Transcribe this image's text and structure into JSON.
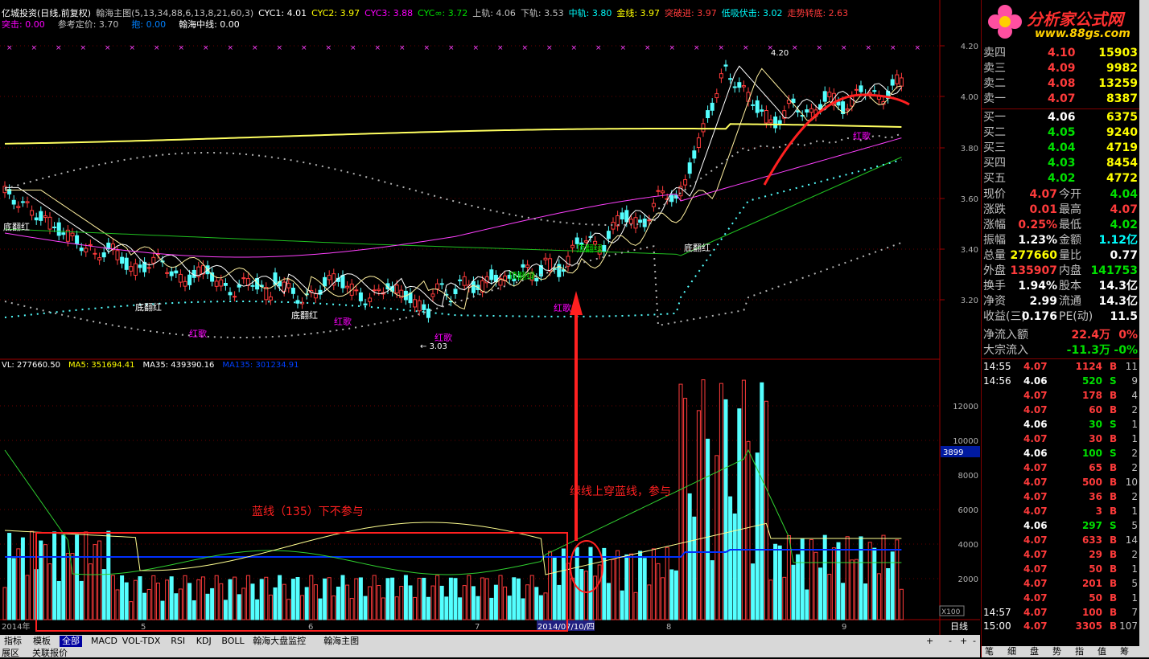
{
  "header": {
    "line1": [
      {
        "text": "亿城投资(日线,前复权)",
        "color": "#ffffff"
      },
      {
        "text": "翰海主图(5,13,34,88,6,13,8,21,60,3)",
        "color": "#c0c0c0"
      },
      {
        "text": "CYC1: 4.01",
        "color": "#ffffff"
      },
      {
        "text": "CYC2: 3.97",
        "color": "#ffff00"
      },
      {
        "text": "CYC3: 3.88",
        "color": "#ff00ff"
      },
      {
        "text": "CYC∞: 3.72",
        "color": "#00e000"
      },
      {
        "text": "上轨: 4.06",
        "color": "#c0c0c0"
      },
      {
        "text": "下轨: 3.53",
        "color": "#c0c0c0"
      },
      {
        "text": "中轨: 3.80",
        "color": "#00ffff"
      },
      {
        "text": "金线: 3.97",
        "color": "#ffff00"
      },
      {
        "text": "突破进: 3.97",
        "color": "#ff3b3b"
      },
      {
        "text": "低吸伏击: 3.02",
        "color": "#00ffff"
      },
      {
        "text": "走势转底: 2.63",
        "color": "#ff3b3b"
      }
    ],
    "line2": [
      {
        "text": "突击: 0.00",
        "color": "#ff00ff"
      },
      {
        "text": "参考定价: 3.70",
        "color": "#c0c0c0"
      },
      {
        "text": "抱: 0.00",
        "color": "#0080ff"
      },
      {
        "text": "翰海中线: 0.00",
        "color": "#ffffff"
      }
    ]
  },
  "price_axis": [
    "4.20",
    "4.00",
    "3.80",
    "3.60",
    "3.40",
    "3.20"
  ],
  "volume_axis": [
    "12000",
    "10000",
    "8000",
    "6000",
    "4000",
    "2000"
  ],
  "volume_axis_marker": "3899",
  "volume_header": [
    {
      "text": "VL: 277660.50",
      "color": "#ffffff"
    },
    {
      "text": "MA5: 351694.41",
      "color": "#ffff00"
    },
    {
      "text": "MA35: 439390.16",
      "color": "#ffffff"
    },
    {
      "text": "MA135: 301234.91",
      "color": "#0040ff"
    }
  ],
  "chart_labels": {
    "high": "4.20",
    "low": "3.03",
    "signals": [
      {
        "text": "底翻红",
        "color": "#ffffff"
      },
      {
        "text": "底翻红",
        "color": "#ffffff"
      },
      {
        "text": "红歌",
        "color": "#ff00ff"
      },
      {
        "text": "底翻红",
        "color": "#ffffff"
      },
      {
        "text": "红歌",
        "color": "#ff00ff"
      },
      {
        "text": "红歌",
        "color": "#ff00ff"
      },
      {
        "text": "顶翻绿",
        "color": "#00e000"
      },
      {
        "text": "红歌",
        "color": "#ff00ff"
      },
      {
        "text": "顶翻绿",
        "color": "#00e000"
      },
      {
        "text": "底翻红",
        "color": "#ffffff"
      },
      {
        "text": "红歌",
        "color": "#ff00ff"
      }
    ],
    "annotation_left": "蓝线（135）下不参与",
    "annotation_right": "绿线上穿蓝线，参与"
  },
  "time_axis": {
    "labels": [
      "2014年",
      "5",
      "6",
      "7",
      "2014/07/10/四",
      "8",
      "9"
    ],
    "period": "日线"
  },
  "tabs": [
    "指标",
    "模板",
    "全部",
    "MACD",
    "VOL-TDX",
    "RSI",
    "KDJ",
    "BOLL",
    "翰海大盘监控",
    "翰海主图"
  ],
  "tab_active": "全部",
  "scroll_buttons": [
    "+",
    "-",
    "+",
    "-"
  ],
  "status": [
    "展区",
    "关联报价"
  ],
  "logo": {
    "title": "分析家公式网",
    "url": "www.88gs.com"
  },
  "order_book": {
    "asks": [
      {
        "label": "卖四",
        "price": "4.10",
        "vol": "15903"
      },
      {
        "label": "卖三",
        "price": "4.09",
        "vol": "9982"
      },
      {
        "label": "卖二",
        "price": "4.08",
        "vol": "13259"
      },
      {
        "label": "卖一",
        "price": "4.07",
        "vol": "8387"
      }
    ],
    "bids": [
      {
        "label": "买一",
        "price": "4.06",
        "vol": "6375"
      },
      {
        "label": "买二",
        "price": "4.05",
        "vol": "9240"
      },
      {
        "label": "买三",
        "price": "4.04",
        "vol": "4719"
      },
      {
        "label": "买四",
        "price": "4.03",
        "vol": "8454"
      },
      {
        "label": "买五",
        "price": "4.02",
        "vol": "4772"
      }
    ]
  },
  "quote": [
    {
      "l1": "现价",
      "v1": "4.07",
      "c1": "red",
      "l2": "今开",
      "v2": "4.04",
      "c2": "green"
    },
    {
      "l1": "涨跌",
      "v1": "0.01",
      "c1": "red",
      "l2": "最高",
      "v2": "4.07",
      "c2": "red"
    },
    {
      "l1": "涨幅",
      "v1": "0.25%",
      "c1": "red",
      "l2": "最低",
      "v2": "4.02",
      "c2": "green"
    },
    {
      "l1": "振幅",
      "v1": "1.23%",
      "c1": "white",
      "l2": "金额",
      "v2": "1.12亿",
      "c2": "cyan"
    },
    {
      "l1": "总量",
      "v1": "277660",
      "c1": "yellow",
      "l2": "量比",
      "v2": "0.77",
      "c2": "white"
    },
    {
      "l1": "外盘",
      "v1": "135907",
      "c1": "red",
      "l2": "内盘",
      "v2": "141753",
      "c2": "green"
    },
    {
      "l1": "换手",
      "v1": "1.94%",
      "c1": "white",
      "l2": "股本",
      "v2": "14.3亿",
      "c2": "white"
    },
    {
      "l1": "净资",
      "v1": "2.99",
      "c1": "white",
      "l2": "流通",
      "v2": "14.3亿",
      "c2": "white"
    },
    {
      "l1": "收益(三)",
      "v1": "0.176",
      "c1": "white",
      "l2": "PE(动)",
      "v2": "11.5",
      "c2": "white"
    }
  ],
  "flows": [
    {
      "label": "净流入额",
      "v1": "22.4万",
      "c1": "red",
      "v2": "0%",
      "c2": "red"
    },
    {
      "label": "大宗流入",
      "v1": "-11.3万",
      "c1": "green",
      "v2": "-0%",
      "c2": "green"
    }
  ],
  "ticks": [
    {
      "time": "14:55",
      "price": "4.07",
      "vol": "1124",
      "side": "B",
      "n": "11"
    },
    {
      "time": "14:56",
      "price": "4.06",
      "vol": "520",
      "side": "S",
      "n": "9"
    },
    {
      "time": "",
      "price": "4.07",
      "vol": "178",
      "side": "B",
      "n": "4"
    },
    {
      "time": "",
      "price": "4.07",
      "vol": "60",
      "side": "B",
      "n": "2"
    },
    {
      "time": "",
      "price": "4.06",
      "vol": "30",
      "side": "S",
      "n": "1"
    },
    {
      "time": "",
      "price": "4.07",
      "vol": "30",
      "side": "B",
      "n": "1"
    },
    {
      "time": "",
      "price": "4.06",
      "vol": "100",
      "side": "S",
      "n": "2"
    },
    {
      "time": "",
      "price": "4.07",
      "vol": "65",
      "side": "B",
      "n": "2"
    },
    {
      "time": "",
      "price": "4.07",
      "vol": "500",
      "side": "B",
      "n": "10"
    },
    {
      "time": "",
      "price": "4.07",
      "vol": "36",
      "side": "B",
      "n": "2"
    },
    {
      "time": "",
      "price": "4.07",
      "vol": "3",
      "side": "B",
      "n": "1"
    },
    {
      "time": "",
      "price": "4.06",
      "vol": "297",
      "side": "S",
      "n": "5"
    },
    {
      "time": "",
      "price": "4.07",
      "vol": "633",
      "side": "B",
      "n": "14"
    },
    {
      "time": "",
      "price": "4.07",
      "vol": "29",
      "side": "B",
      "n": "2"
    },
    {
      "time": "",
      "price": "4.07",
      "vol": "50",
      "side": "B",
      "n": "1"
    },
    {
      "time": "",
      "price": "4.07",
      "vol": "201",
      "side": "B",
      "n": "5"
    },
    {
      "time": "",
      "price": "4.07",
      "vol": "50",
      "side": "B",
      "n": "1"
    },
    {
      "time": "14:57",
      "price": "4.07",
      "vol": "100",
      "side": "B",
      "n": "7"
    },
    {
      "time": "15:00",
      "price": "4.07",
      "vol": "3305",
      "side": "B",
      "n": "107"
    }
  ],
  "bottom_tabs": [
    "笔",
    "细",
    "盘",
    "势",
    "指",
    "值",
    "筹"
  ],
  "colors": {
    "up": "#ff3b3b",
    "down": "#54ffff",
    "ma135": "#0030ff",
    "grid": "#800000",
    "annotation": "#ff2020"
  }
}
